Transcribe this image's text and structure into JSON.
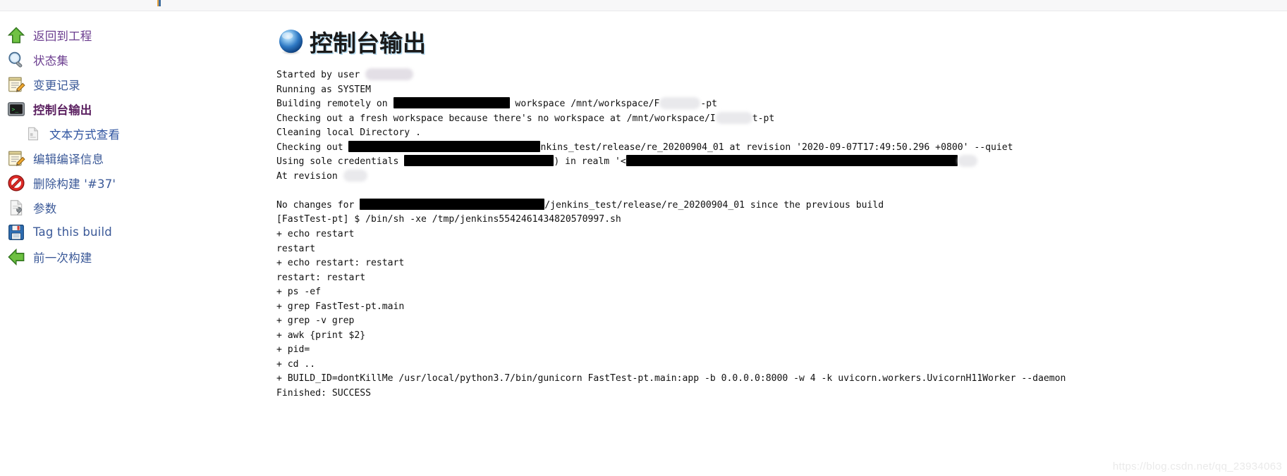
{
  "window": {
    "title": "控制台输出"
  },
  "sidebar": {
    "items": [
      {
        "label": "返回到工程",
        "icon": "up-arrow-green-icon",
        "name": "sidebar-item-back-to-project",
        "style": "purple",
        "sub": false
      },
      {
        "label": "状态集",
        "icon": "magnifier-icon",
        "name": "sidebar-item-status",
        "style": "purple",
        "sub": false
      },
      {
        "label": "变更记录",
        "icon": "notepad-pencil-icon",
        "name": "sidebar-item-changes",
        "style": "normal",
        "sub": false
      },
      {
        "label": "控制台输出",
        "icon": "terminal-icon",
        "name": "sidebar-item-console-output",
        "style": "current",
        "sub": false
      },
      {
        "label": "文本方式查看",
        "icon": "document-plain-icon",
        "name": "sidebar-item-view-as-plain-text",
        "style": "normal",
        "sub": true
      },
      {
        "label": "编辑编译信息",
        "icon": "notepad-pencil-icon",
        "name": "sidebar-item-edit-build-information",
        "style": "normal",
        "sub": false
      },
      {
        "label": "删除构建 '#37'",
        "icon": "no-entry-icon",
        "name": "sidebar-item-delete-build",
        "style": "normal",
        "sub": false
      },
      {
        "label": "参数",
        "icon": "document-wrench-icon",
        "name": "sidebar-item-parameters",
        "style": "normal",
        "sub": false
      },
      {
        "label": "Tag this build",
        "icon": "floppy-disk-icon",
        "name": "sidebar-item-tag-this-build",
        "style": "normal",
        "sub": false
      },
      {
        "label": "前一次构建",
        "icon": "left-arrow-green-icon",
        "name": "sidebar-item-previous-build",
        "style": "normal",
        "sub": false
      }
    ]
  },
  "console": {
    "lines": [
      {
        "segments": [
          {
            "t": "Started by user "
          },
          {
            "blur": 68,
            "tint": true
          }
        ]
      },
      {
        "segments": [
          {
            "t": "Running as SYSTEM"
          }
        ]
      },
      {
        "segments": [
          {
            "t": "Building remotely on "
          },
          {
            "redact": 165
          },
          {
            "t": " workspace /mnt/workspace/F"
          },
          {
            "blur": 58
          },
          {
            "t": "-pt"
          }
        ]
      },
      {
        "segments": [
          {
            "t": "Checking out a fresh workspace because there's no workspace at /mnt/workspace/I"
          },
          {
            "blur": 52
          },
          {
            "t": "t-pt"
          }
        ]
      },
      {
        "segments": [
          {
            "t": "Cleaning local Directory ."
          }
        ]
      },
      {
        "segments": [
          {
            "t": "Checking out "
          },
          {
            "redact": 272
          },
          {
            "t": "nkins_test/release/re_20200904_01 at revision '2020-09-07T17:49:50.296 +0800' --quiet"
          }
        ]
      },
      {
        "segments": [
          {
            "t": "Using sole credentials "
          },
          {
            "redact": 212
          },
          {
            "t": ") in realm '<"
          },
          {
            "redact": 470
          },
          {
            "blur": 28
          }
        ]
      },
      {
        "segments": [
          {
            "t": "At revision "
          },
          {
            "blur": 34
          }
        ]
      },
      {
        "segments": []
      },
      {
        "segments": [
          {
            "t": "No changes for "
          },
          {
            "redact": 262
          },
          {
            "t": "/jenkins_test/release/re_20200904_01 since the previous build"
          }
        ]
      },
      {
        "segments": [
          {
            "t": "[FastTest-pt] $ /bin/sh -xe /tmp/jenkins5542461434820570997.sh"
          }
        ]
      },
      {
        "segments": [
          {
            "t": "+ echo restart"
          }
        ]
      },
      {
        "segments": [
          {
            "t": "restart"
          }
        ]
      },
      {
        "segments": [
          {
            "t": "+ echo restart: restart"
          }
        ]
      },
      {
        "segments": [
          {
            "t": "restart: restart"
          }
        ]
      },
      {
        "segments": [
          {
            "t": "+ ps -ef"
          }
        ]
      },
      {
        "segments": [
          {
            "t": "+ grep FastTest-pt.main"
          }
        ]
      },
      {
        "segments": [
          {
            "t": "+ grep -v grep"
          }
        ]
      },
      {
        "segments": [
          {
            "t": "+ awk {print $2}"
          }
        ]
      },
      {
        "segments": [
          {
            "t": "+ pid="
          }
        ]
      },
      {
        "segments": [
          {
            "t": "+ cd .."
          }
        ]
      },
      {
        "segments": [
          {
            "t": "+ BUILD_ID=dontKillMe /usr/local/python3.7/bin/gunicorn FastTest-pt.main:app -b 0.0.0.0:8000 -w 4 -k uvicorn.workers.UvicornH11Worker --daemon"
          }
        ]
      },
      {
        "segments": [
          {
            "t": "Finished: SUCCESS"
          }
        ]
      }
    ]
  },
  "watermark": {
    "text": "https://blog.csdn.net/qq_23934063"
  },
  "colors": {
    "link": "#3b5998",
    "current": "#5b2060",
    "purple_link": "#6b3d8f",
    "console_text": "#111111",
    "redact": "#000000",
    "watermark": "#eaeaea"
  }
}
